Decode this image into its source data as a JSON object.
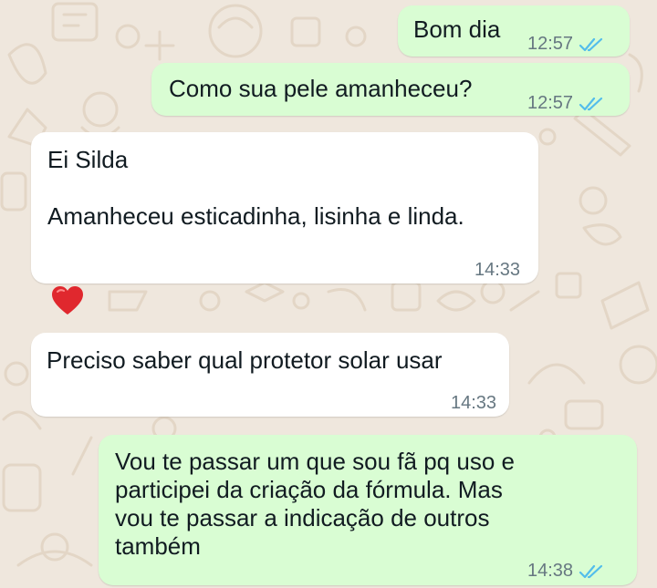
{
  "accent_colors": {
    "outgoing_bubble": "#d9fdd3",
    "incoming_bubble": "#ffffff",
    "read_ticks": "#53bdeb",
    "wallpaper": "#efe7dd"
  },
  "messages": [
    {
      "direction": "outgoing",
      "text": "Bom dia",
      "time": "12:57",
      "status_icon": "double-check-read-icon"
    },
    {
      "direction": "outgoing",
      "text": "Como sua pele amanheceu?",
      "time": "12:57",
      "status_icon": "double-check-read-icon"
    },
    {
      "direction": "incoming",
      "text": "Ei Silda\n\nAmanheceu esticadinha, lisinha e linda.",
      "time": "14:33",
      "reaction": "heart-icon"
    },
    {
      "direction": "incoming",
      "text": "Preciso saber qual protetor solar usar",
      "time": "14:33"
    },
    {
      "direction": "outgoing",
      "text": "Vou te passar um que sou fã pq uso e\nparticipei da criação da fórmula. Mas\nvou te passar a indicação de outros\ntambém",
      "time": "14:38",
      "status_icon": "double-check-read-icon"
    }
  ]
}
